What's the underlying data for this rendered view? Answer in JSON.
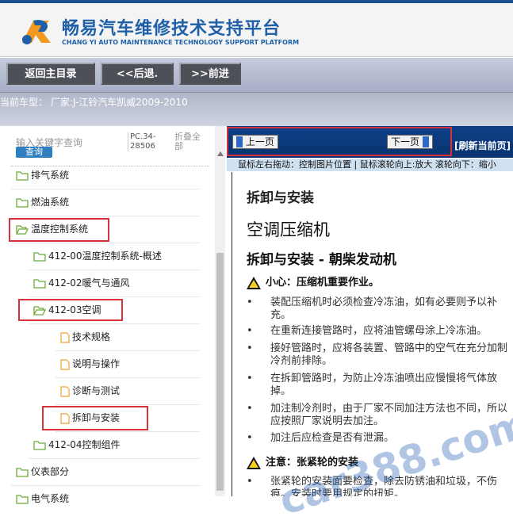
{
  "header": {
    "title_cn": "畅易汽车维修技术支持平台",
    "title_en": "CHANG YI AUTO MAINTENANCE TECHNOLOGY SUPPORT PLATFORM"
  },
  "nav": {
    "home": "返回主目录",
    "back": "<<后退.",
    "forward": ">>前进"
  },
  "car": {
    "line": "当前车型： 厂家:J-江铃汽车凯威2009-2010"
  },
  "sidebar": {
    "search_placeholder": "输入关键字查询",
    "search_button": "查询",
    "pc_code": "PC.34-28506",
    "fold_all": "折叠全部",
    "items": [
      {
        "label": "排气系统"
      },
      {
        "label": "燃油系统"
      },
      {
        "label": "温度控制系统"
      },
      {
        "label": "412-00温度控制系统-概述"
      },
      {
        "label": "412-02暖气与通风"
      },
      {
        "label": "412-03空调"
      },
      {
        "label": "技术规格"
      },
      {
        "label": "说明与操作"
      },
      {
        "label": "诊断与测试"
      },
      {
        "label": "拆卸与安装"
      },
      {
        "label": "412-04控制组件"
      },
      {
        "label": "仪表部分"
      },
      {
        "label": "电气系统"
      }
    ]
  },
  "viewer": {
    "prev_page": "上一页",
    "next_page": "下一页",
    "refresh": "刷新当前页",
    "tips": "鼠标左右拖动：控制图片位置 | 鼠标滚轮向上:放大  滚轮向下：缩小"
  },
  "doc": {
    "h1": "拆卸与安装",
    "h2": "空调压缩机",
    "h3": "拆卸与安装 - 朝柴发动机",
    "caution_title": "小心：压缩机重要作业。",
    "bullets": [
      "装配压缩机时必须检查冷冻油，如有必要则予以补充。",
      "在重新连接管路时，应将油管螺母涂上冷冻油。",
      "接好管路时，应将各装置、管路中的空气在充分加制冷剂前排除。",
      "在拆卸管路时，为防止冷冻油喷出应慢慢将气体放掉。",
      "加注制冷剂时，由于厂家不同加注方法也不同，所以应按照厂家说明去加注。",
      "加注后应检查是否有泄漏。"
    ],
    "note_title": "注意：张紧轮的安装",
    "note_bullet": "张紧轮的安装面要检查，除去防锈油和垃圾，不伤痕。安装时要用规定的扭矩。"
  },
  "watermark": "car388.com",
  "colors": {
    "brand_blue": "#1f5fa8",
    "pager_bg": "#0e3f86",
    "highlight_red": "#d9303a",
    "folder_green": "#6cab3b",
    "file_orange": "#f0a030"
  }
}
